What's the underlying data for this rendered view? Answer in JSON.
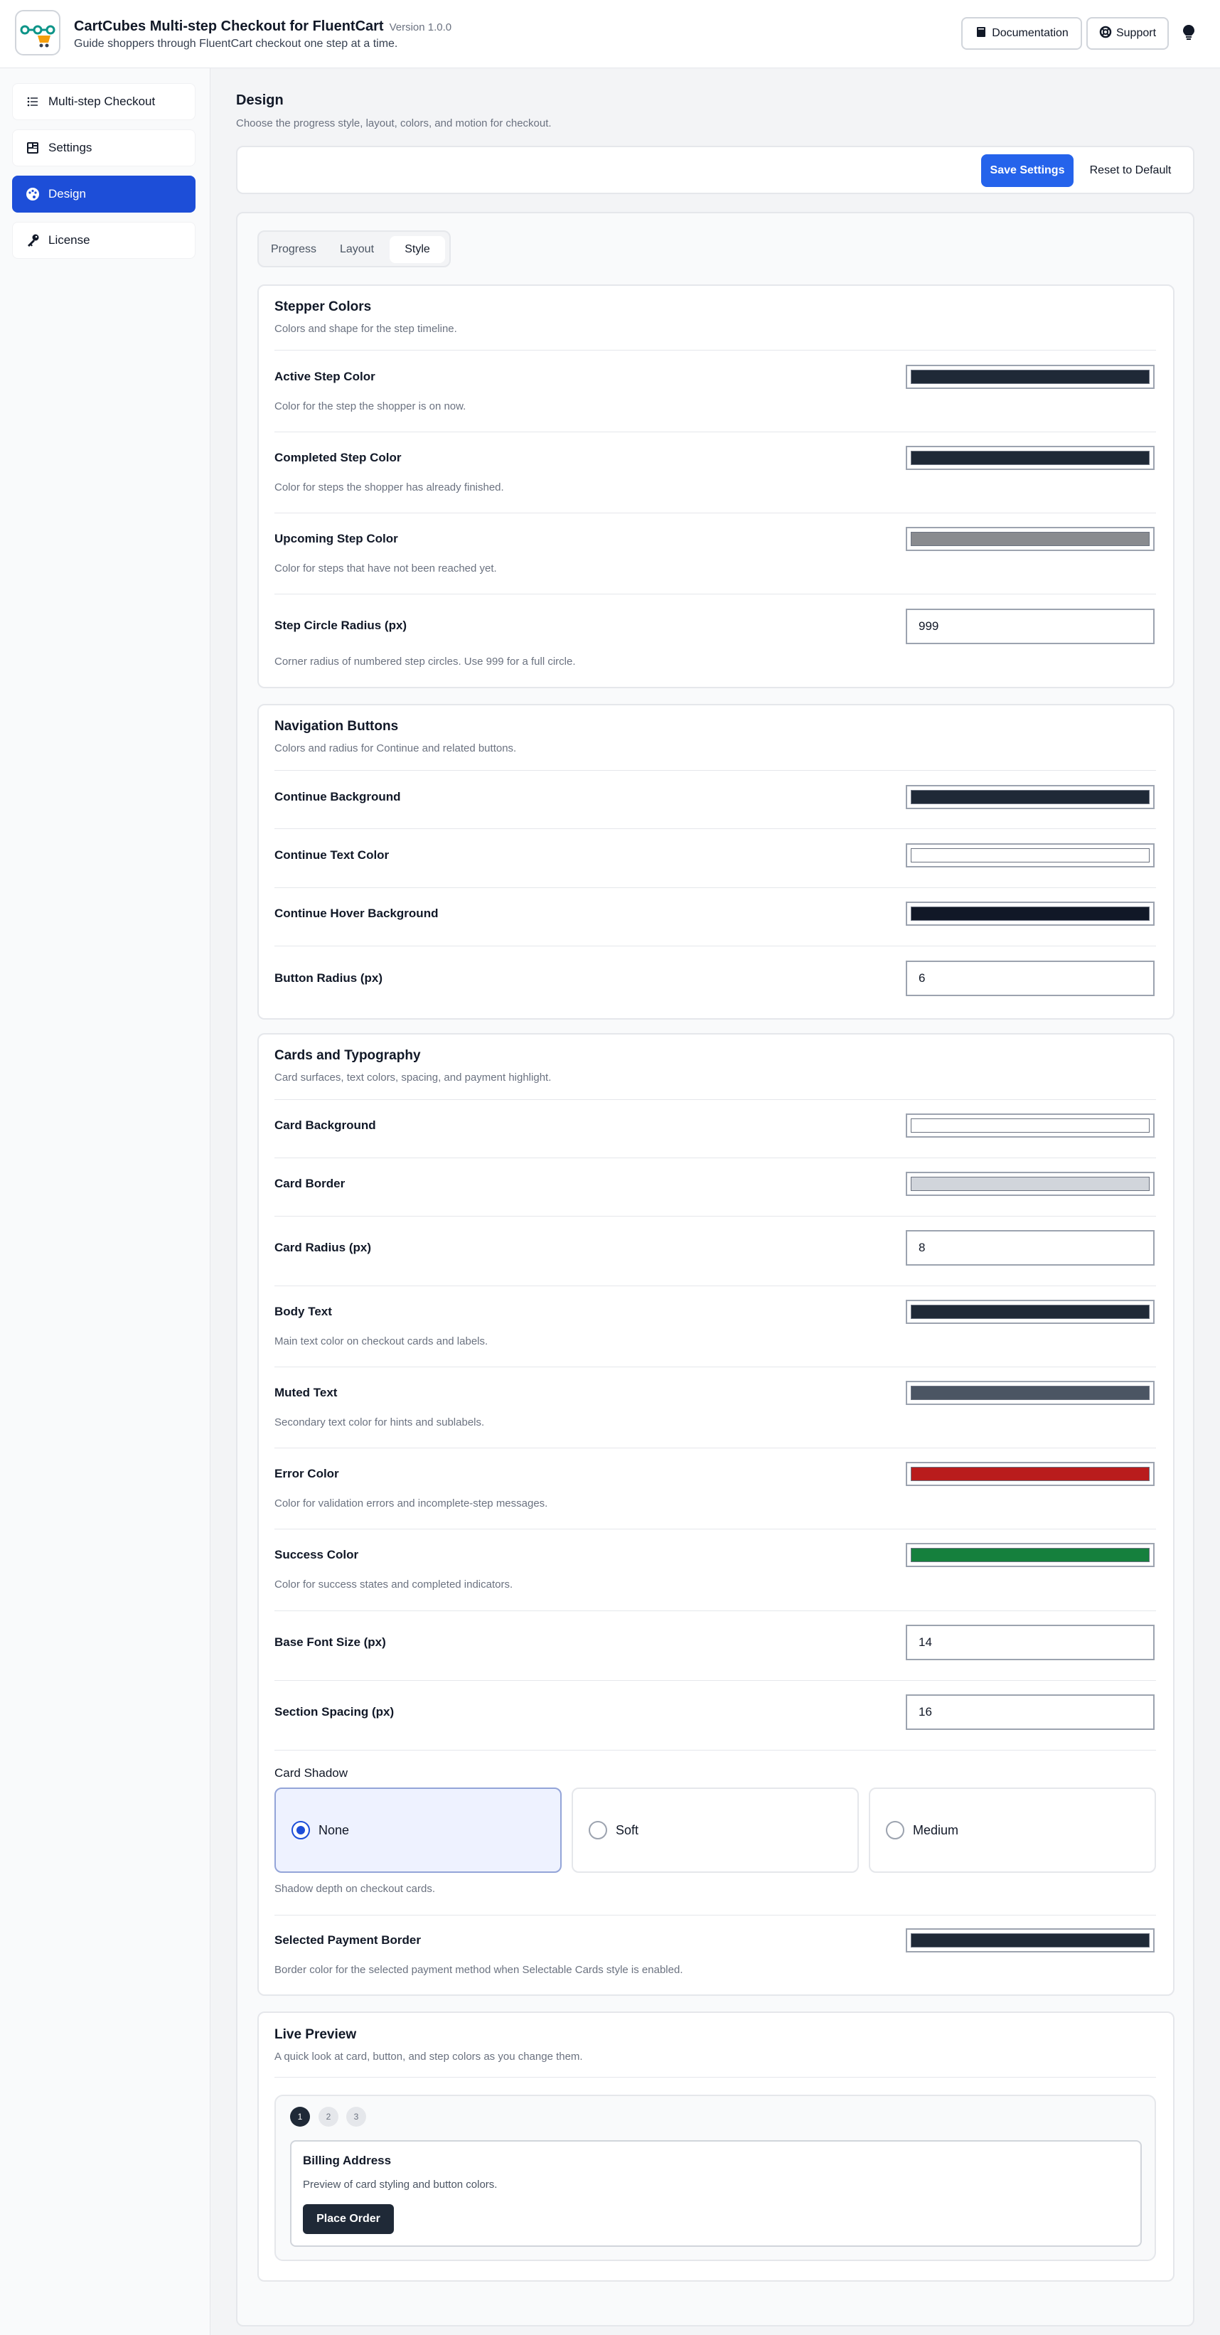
{
  "header": {
    "title": "CartCubes Multi-step Checkout for FluentCart",
    "version": "Version 1.0.0",
    "subtitle": "Guide shoppers through FluentCart checkout one step at a time.",
    "documentation_label": "Documentation",
    "support_label": "Support",
    "theme_icon": "lightbulb-icon"
  },
  "sidebar": {
    "items": [
      {
        "label": "Multi-step Checkout",
        "icon": "list-steps-icon",
        "active": false
      },
      {
        "label": "Settings",
        "icon": "dashboard-icon",
        "active": false
      },
      {
        "label": "Design",
        "icon": "palette-icon",
        "active": true
      },
      {
        "label": "License",
        "icon": "key-icon",
        "active": false
      }
    ]
  },
  "page": {
    "title": "Design",
    "subtitle": "Choose the progress style, layout, colors, and motion for checkout.",
    "save_label": "Save Settings",
    "reset_label": "Reset to Default"
  },
  "tabs": [
    "Progress",
    "Layout",
    "Style"
  ],
  "active_tab": "Style",
  "stepper": {
    "title": "Stepper Colors",
    "subtitle": "Colors and shape for the step timeline.",
    "active_label": "Active Step Color",
    "active_help": "Color for the step the shopper is on now.",
    "active_color": "#1f2937",
    "completed_label": "Completed Step Color",
    "completed_help": "Color for steps the shopper has already finished.",
    "completed_color": "#1f2937",
    "upcoming_label": "Upcoming Step Color",
    "upcoming_help": "Color for steps that have not been reached yet.",
    "upcoming_color": "#898b8f",
    "radius_label": "Step Circle Radius (px)",
    "radius_value": "999",
    "radius_help": "Corner radius of numbered step circles. Use 999 for a full circle."
  },
  "navigation": {
    "title": "Navigation Buttons",
    "subtitle": "Colors and radius for Continue and related buttons.",
    "bg_label": "Continue Background",
    "bg_color": "#1f2937",
    "text_label": "Continue Text Color",
    "text_color": "#ffffff",
    "hover_label": "Continue Hover Background",
    "hover_color": "#111827",
    "radius_label": "Button Radius (px)",
    "radius_value": "6"
  },
  "cards": {
    "title": "Cards and Typography",
    "subtitle": "Card surfaces, text colors, spacing, and payment highlight.",
    "bg_label": "Card Background",
    "bg_color": "#ffffff",
    "border_label": "Card Border",
    "border_color": "#d1d5db",
    "radius_label": "Card Radius (px)",
    "radius_value": "8",
    "body_label": "Body Text",
    "body_help": "Main text color on checkout cards and labels.",
    "body_color": "#1f2937",
    "muted_label": "Muted Text",
    "muted_help": "Secondary text color for hints and sublabels.",
    "muted_color": "#4b5563",
    "error_label": "Error Color",
    "error_help": "Color for validation errors and incomplete-step messages.",
    "error_color": "#b91c1c",
    "success_label": "Success Color",
    "success_help": "Color for success states and completed indicators.",
    "success_color": "#15803d",
    "font_label": "Base Font Size (px)",
    "font_value": "14",
    "spacing_label": "Section Spacing (px)",
    "spacing_value": "16",
    "shadow_label": "Card Shadow",
    "shadow_options": [
      "None",
      "Soft",
      "Medium"
    ],
    "shadow_selected": "None",
    "shadow_help": "Shadow depth on checkout cards.",
    "payment_label": "Selected Payment Border",
    "payment_help": "Border color for the selected payment method when Selectable Cards style is enabled.",
    "payment_color": "#1f2937"
  },
  "preview": {
    "title": "Live Preview",
    "subtitle": "A quick look at card, button, and step colors as you change them.",
    "steps": [
      "1",
      "2",
      "3"
    ],
    "card_title": "Billing Address",
    "card_sub": "Preview of card styling and button colors.",
    "button_label": "Place Order"
  }
}
